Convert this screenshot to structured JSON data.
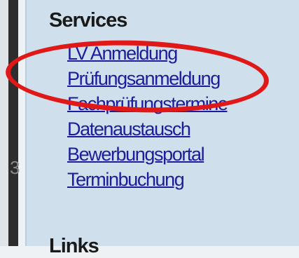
{
  "sidebar": {
    "services_title": "Services",
    "links": [
      {
        "label": "LV Anmeldung"
      },
      {
        "label": "Prüfungsanmeldung"
      },
      {
        "label": "Fachprüfungstermine"
      },
      {
        "label": "Datenaustausch"
      },
      {
        "label": "Bewerbungsportal"
      },
      {
        "label": "Terminbuchung"
      }
    ],
    "next_section_title": "Links"
  },
  "left_edge_digit": "3",
  "annotation": {
    "shape": "ellipse",
    "color": "#e01818"
  }
}
